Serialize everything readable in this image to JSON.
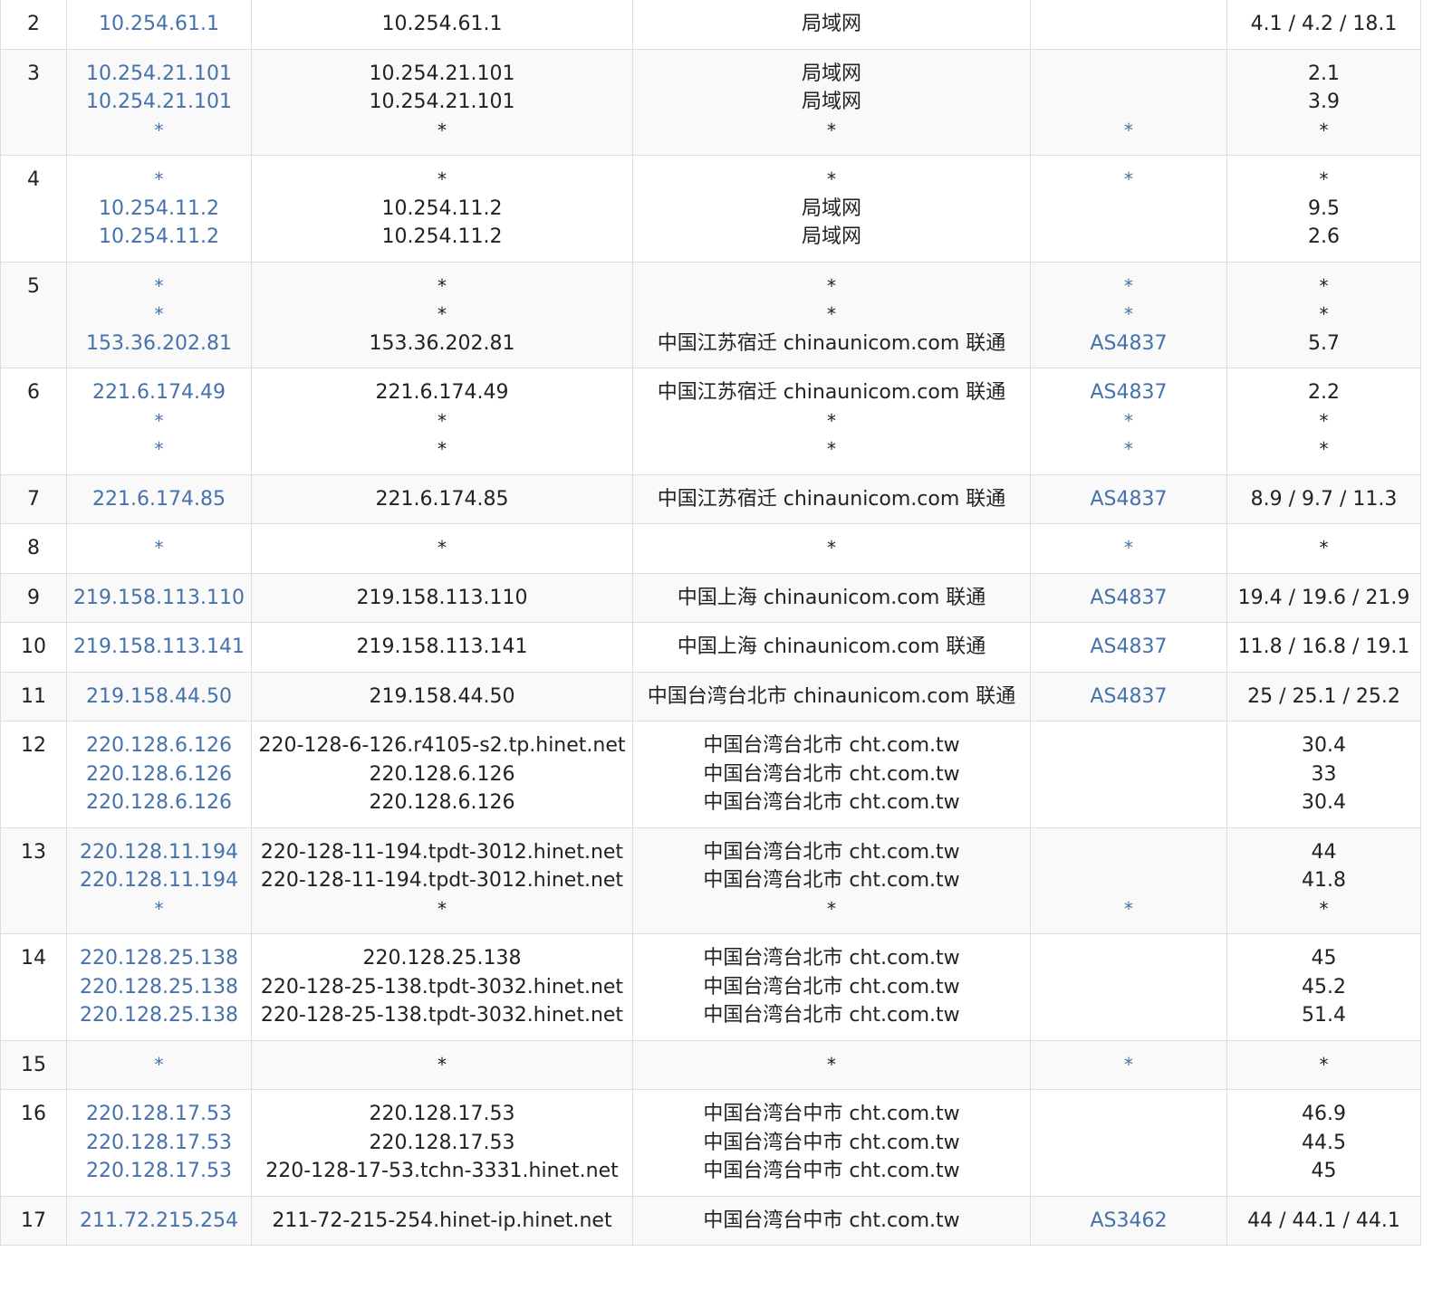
{
  "colors": {
    "link": "#4672ab",
    "text": "#222222",
    "border": "#dddddd",
    "stripe": "#f9f9f9"
  },
  "rows": [
    {
      "hop": "2",
      "ip": [
        "10.254.61.1"
      ],
      "host": [
        "10.254.61.1"
      ],
      "loc": [
        "局域网"
      ],
      "asn": [
        ""
      ],
      "lat": [
        "4.1 / 4.2 / 18.1"
      ]
    },
    {
      "hop": "3",
      "ip": [
        "10.254.21.101",
        "10.254.21.101",
        "*"
      ],
      "host": [
        "10.254.21.101",
        "10.254.21.101",
        "*"
      ],
      "loc": [
        "局域网",
        "局域网",
        "*"
      ],
      "asn": [
        "",
        "",
        "*"
      ],
      "lat": [
        "2.1",
        "3.9",
        "*"
      ]
    },
    {
      "hop": "4",
      "ip": [
        "*",
        "10.254.11.2",
        "10.254.11.2"
      ],
      "host": [
        "*",
        "10.254.11.2",
        "10.254.11.2"
      ],
      "loc": [
        "*",
        "局域网",
        "局域网"
      ],
      "asn": [
        "*",
        "",
        ""
      ],
      "lat": [
        "*",
        "9.5",
        "2.6"
      ]
    },
    {
      "hop": "5",
      "ip": [
        "*",
        "*",
        "153.36.202.81"
      ],
      "host": [
        "*",
        "*",
        "153.36.202.81"
      ],
      "loc": [
        "*",
        "*",
        "中国江苏宿迁 chinaunicom.com 联通"
      ],
      "asn": [
        "*",
        "*",
        "AS4837"
      ],
      "lat": [
        "*",
        "*",
        "5.7"
      ]
    },
    {
      "hop": "6",
      "ip": [
        "221.6.174.49",
        "*",
        "*"
      ],
      "host": [
        "221.6.174.49",
        "*",
        "*"
      ],
      "loc": [
        "中国江苏宿迁 chinaunicom.com 联通",
        "*",
        "*"
      ],
      "asn": [
        "AS4837",
        "*",
        "*"
      ],
      "lat": [
        "2.2",
        "*",
        "*"
      ]
    },
    {
      "hop": "7",
      "ip": [
        "221.6.174.85"
      ],
      "host": [
        "221.6.174.85"
      ],
      "loc": [
        "中国江苏宿迁 chinaunicom.com 联通"
      ],
      "asn": [
        "AS4837"
      ],
      "lat": [
        "8.9 / 9.7 / 11.3"
      ]
    },
    {
      "hop": "8",
      "ip": [
        "*"
      ],
      "host": [
        "*"
      ],
      "loc": [
        "*"
      ],
      "asn": [
        "*"
      ],
      "lat": [
        "*"
      ]
    },
    {
      "hop": "9",
      "ip": [
        "219.158.113.110"
      ],
      "host": [
        "219.158.113.110"
      ],
      "loc": [
        "中国上海 chinaunicom.com 联通"
      ],
      "asn": [
        "AS4837"
      ],
      "lat": [
        "19.4 / 19.6 / 21.9"
      ]
    },
    {
      "hop": "10",
      "ip": [
        "219.158.113.141"
      ],
      "host": [
        "219.158.113.141"
      ],
      "loc": [
        "中国上海 chinaunicom.com 联通"
      ],
      "asn": [
        "AS4837"
      ],
      "lat": [
        "11.8 / 16.8 / 19.1"
      ]
    },
    {
      "hop": "11",
      "ip": [
        "219.158.44.50"
      ],
      "host": [
        "219.158.44.50"
      ],
      "loc": [
        "中国台湾台北市 chinaunicom.com 联通"
      ],
      "asn": [
        "AS4837"
      ],
      "lat": [
        "25 / 25.1 / 25.2"
      ]
    },
    {
      "hop": "12",
      "ip": [
        "220.128.6.126",
        "220.128.6.126",
        "220.128.6.126"
      ],
      "host": [
        "220-128-6-126.r4105-s2.tp.hinet.net",
        "220.128.6.126",
        "220.128.6.126"
      ],
      "loc": [
        "中国台湾台北市 cht.com.tw",
        "中国台湾台北市 cht.com.tw",
        "中国台湾台北市 cht.com.tw"
      ],
      "asn": [
        "",
        "",
        ""
      ],
      "lat": [
        "30.4",
        "33",
        "30.4"
      ]
    },
    {
      "hop": "13",
      "ip": [
        "220.128.11.194",
        "220.128.11.194",
        "*"
      ],
      "host": [
        "220-128-11-194.tpdt-3012.hinet.net",
        "220-128-11-194.tpdt-3012.hinet.net",
        "*"
      ],
      "loc": [
        "中国台湾台北市 cht.com.tw",
        "中国台湾台北市 cht.com.tw",
        "*"
      ],
      "asn": [
        "",
        "",
        "*"
      ],
      "lat": [
        "44",
        "41.8",
        "*"
      ]
    },
    {
      "hop": "14",
      "ip": [
        "220.128.25.138",
        "220.128.25.138",
        "220.128.25.138"
      ],
      "host": [
        "220.128.25.138",
        "220-128-25-138.tpdt-3032.hinet.net",
        "220-128-25-138.tpdt-3032.hinet.net"
      ],
      "loc": [
        "中国台湾台北市 cht.com.tw",
        "中国台湾台北市 cht.com.tw",
        "中国台湾台北市 cht.com.tw"
      ],
      "asn": [
        "",
        "",
        ""
      ],
      "lat": [
        "45",
        "45.2",
        "51.4"
      ]
    },
    {
      "hop": "15",
      "ip": [
        "*"
      ],
      "host": [
        "*"
      ],
      "loc": [
        "*"
      ],
      "asn": [
        "*"
      ],
      "lat": [
        "*"
      ]
    },
    {
      "hop": "16",
      "ip": [
        "220.128.17.53",
        "220.128.17.53",
        "220.128.17.53"
      ],
      "host": [
        "220.128.17.53",
        "220.128.17.53",
        "220-128-17-53.tchn-3331.hinet.net"
      ],
      "loc": [
        "中国台湾台中市 cht.com.tw",
        "中国台湾台中市 cht.com.tw",
        "中国台湾台中市 cht.com.tw"
      ],
      "asn": [
        "",
        "",
        ""
      ],
      "lat": [
        "46.9",
        "44.5",
        "45"
      ]
    },
    {
      "hop": "17",
      "ip": [
        "211.72.215.254"
      ],
      "host": [
        "211-72-215-254.hinet-ip.hinet.net"
      ],
      "loc": [
        "中国台湾台中市 cht.com.tw"
      ],
      "asn": [
        "AS3462"
      ],
      "lat": [
        "44 / 44.1 / 44.1"
      ]
    }
  ]
}
